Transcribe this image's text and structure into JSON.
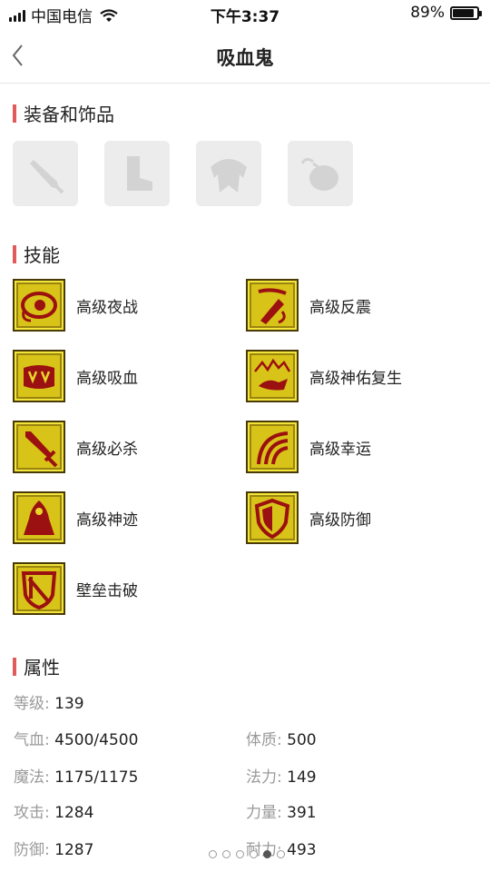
{
  "status_bar": {
    "carrier": "中国电信",
    "time": "下午3:37",
    "battery_percent": "89%",
    "battery_level": 0.89
  },
  "nav": {
    "title": "吸血鬼"
  },
  "equipment": {
    "title": "装备和饰品",
    "slots": [
      {
        "icon": "sword-icon"
      },
      {
        "icon": "boot-icon"
      },
      {
        "icon": "armor-icon"
      },
      {
        "icon": "pouch-icon"
      }
    ]
  },
  "skills": {
    "title": "技能",
    "items": [
      {
        "name": "高级夜战",
        "icon": "night-eye-icon"
      },
      {
        "name": "高级反震",
        "icon": "counter-shock-icon"
      },
      {
        "name": "高级吸血",
        "icon": "vampire-fang-icon"
      },
      {
        "name": "高级神佑复生",
        "icon": "revive-icon"
      },
      {
        "name": "高级必杀",
        "icon": "critical-sword-icon"
      },
      {
        "name": "高级幸运",
        "icon": "luck-icon"
      },
      {
        "name": "高级神迹",
        "icon": "miracle-icon"
      },
      {
        "name": "高级防御",
        "icon": "shield-icon"
      },
      {
        "name": "壁垒击破",
        "icon": "barrier-break-icon"
      }
    ]
  },
  "attributes": {
    "title": "属性",
    "level": {
      "label": "等级:",
      "value": "139"
    },
    "hp": {
      "label": "气血:",
      "value": "4500/4500"
    },
    "constitution": {
      "label": "体质:",
      "value": "500"
    },
    "mp": {
      "label": "魔法:",
      "value": "1175/1175"
    },
    "magic_power": {
      "label": "法力:",
      "value": "149"
    },
    "attack": {
      "label": "攻击:",
      "value": "1284"
    },
    "strength": {
      "label": "力量:",
      "value": "391"
    },
    "defense": {
      "label": "防御:",
      "value": "1287"
    },
    "endurance": {
      "label": "耐力:",
      "value": "493"
    }
  },
  "pagination": {
    "count": 6,
    "active_index": 4
  },
  "colors": {
    "accent": "#e35a5a",
    "skill_bg": "#d8c318",
    "skill_mark": "#9b1010"
  }
}
